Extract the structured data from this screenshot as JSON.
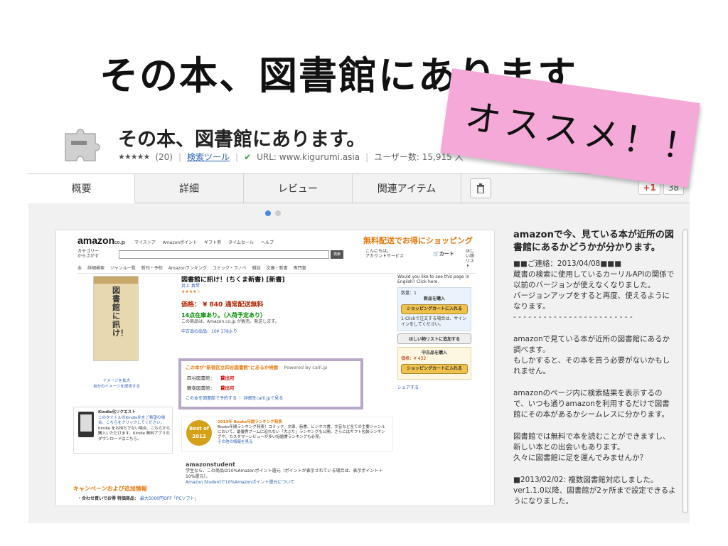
{
  "slide": {
    "title": "その本、図書館にあります"
  },
  "sticky": {
    "text": "オススメ！！"
  },
  "extension": {
    "name": "その本、図書館にあります。",
    "rating_stars": "★★★★★",
    "rating_count": "(20)",
    "category": "検索ツール",
    "url_label": "URL: www.kigurumi.asia",
    "users": "ユーザー数: 15,915 人"
  },
  "tabs": [
    {
      "label": "概要"
    },
    {
      "label": "詳細"
    },
    {
      "label": "レビュー"
    },
    {
      "label": "関連アイテム"
    }
  ],
  "gplus": {
    "label": "+1",
    "count": "38"
  },
  "amazon": {
    "logo": "amazon",
    "logo_suffix": "co.jp",
    "nav": [
      "マイストア",
      "Amazonポイント",
      "ギフト券",
      "タイムセール",
      "ヘルプ"
    ],
    "promo": "無料配送でお得にショッピング",
    "category_label": "カテゴリー\nからさがす",
    "search_btn": "検索",
    "account": "こんにちは。\nアカウントサービス",
    "cart": "カート",
    "wishlist": "ほしい物\nリスト",
    "cats": [
      "本",
      "詳細検索",
      "ジャンル一覧",
      "新刊・予約",
      "Amazonランキング",
      "コミック・ラノベ",
      "雑誌",
      "文庫・新書",
      "専門書"
    ],
    "cover_title": "図書館に訊け！",
    "book_title": "図書館に訊け！(ちくま新書) [新書]",
    "author": "井上 真琴",
    "price": "価格： ¥ 840 通常配送無料",
    "stock": "14点在庫あり。（入荷予定あり）",
    "seller_note": "この商品は、Amazon.co.jp が販売、発送します。",
    "used": "中古品の出品：10¥ 178より",
    "lib_head": "この本が\"新宿区立四谷図書館\"にあるか検索",
    "lib_powered": "Powered by calil.jp",
    "lib_rows": [
      {
        "name": "四谷図書館：",
        "status": "貸出可"
      },
      {
        "name": "鶴巻図書館：",
        "status": "貸出可"
      }
    ],
    "lib_foot": "この本を図書館で予約する",
    "lib_foot2": "詳細をcalil.jpで見る",
    "image_link": "イメージを拡大",
    "own_image": "自分のイメージを提供する",
    "kindle_head": "Kindle化リクエスト",
    "kindle_text": "このタイトルのKindle化をご希望の場合、こちらをクリックしてください。",
    "kindle_text2": "Kindle をお持ちでない場合、こちらから購入いただけます。Kindle 無料アプリのダウンロードはこちら。",
    "best_badge": "Best of\n2012",
    "best_head": "2013年 Books年間ランキング発表",
    "best_text": "Books年間ランキング発表！コミック、文庫、新書、ビジネス書、文芸など全ての主要ジャンルにおいて、最優秀ブームに迫れない「大ぶり」ランキングも公開。さらにはギフト包装ランキングや、カスタマーレビューが多い話題書ランキングも必見。",
    "best_more": "その他の情報を見る",
    "student_logo": "amazonstudent",
    "student_text": "学生なら、この商品は10%Amazonポイント還元（ポイントが表示されている場合は、表示ポイント＋10%還元）。",
    "student_link": "Amazon Studentで10%Amazonポイント還元について",
    "campaign": "キャンペーンおよび追加情報",
    "campaign_sub": "・合わせ買いでお得 特価商品：",
    "campaign_link": "最大5000円OFF「PCソフト」",
    "buy_note": "Would you like to see this page in English? Click here.",
    "buy_qty": "数量：1",
    "buy_new": "新品を購入",
    "buy_cart": "ショッピングカートに入れる",
    "buy_oneclick": "1-Clickで注文する場合は、サインインをしてください。",
    "wishlist_btn": "ほしい物リストに追加する",
    "used_box": "中古品を購入",
    "used_price": "価格：¥ 432",
    "used_cart": "ショッピングカートに入れる",
    "share": "シェアする"
  },
  "description": {
    "heading": "amazonで今、見ている本が近所の図書館にあるかどうかが分かります。",
    "p1": "■■ご連絡：2013/04/08■■■\n蔵書の検索に使用しているカーリルAPIの関係で以前のバージョンが使えなくなりました。\nバージョンアップをすると再度、使えるようになります。\n- - - - - - - - - - - - - - - - - - - - - - - -",
    "p2": "amazonで見ている本が近所の図書館にあるか調べます。\nもしかすると、その本を買う必要がないかもしれません。",
    "p3": "amazonのページ内に検索結果を表示するので、いつも通りamazonを利用するだけで図書館にその本があるかシームレスに分かります。",
    "p4": "図書館では無料で本を読むことができますし、新しい本との出会いもあります。\n久々に図書館に足を運んでみませんか？",
    "p5": "■2013/02/02: 複数図書館対応しました。\nver1.1.0以降、図書館が2ヶ所まで設定できるようになりました。"
  }
}
